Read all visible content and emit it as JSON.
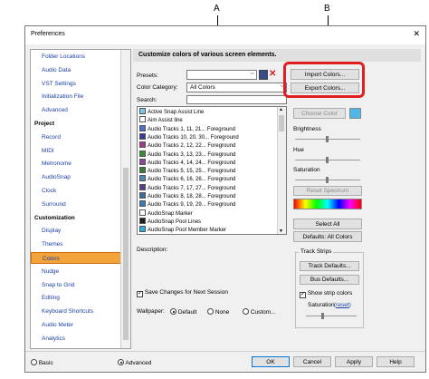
{
  "callouts": {
    "a": "A",
    "b": "B"
  },
  "window": {
    "title": "Preferences",
    "close_glyph": "✕"
  },
  "sidebar": {
    "items": [
      {
        "label": "Folder Locations",
        "style": "blue"
      },
      {
        "label": "Audio Data",
        "style": "blue"
      },
      {
        "label": "VST Settings",
        "style": "blue"
      },
      {
        "label": "Initialization File",
        "style": "blue"
      },
      {
        "label": "Advanced",
        "style": "blue"
      },
      {
        "label": "Project",
        "style": "hdr"
      },
      {
        "label": "Record",
        "style": "blue"
      },
      {
        "label": "MIDI",
        "style": "blue"
      },
      {
        "label": "Metronome",
        "style": "blue"
      },
      {
        "label": "AudioSnap",
        "style": "blue"
      },
      {
        "label": "Clock",
        "style": "blue"
      },
      {
        "label": "Surround",
        "style": "blue"
      },
      {
        "label": "Customization",
        "style": "hdr"
      },
      {
        "label": "Display",
        "style": "blue"
      },
      {
        "label": "Themes",
        "style": "blue"
      },
      {
        "label": "Colors",
        "style": "sel"
      },
      {
        "label": "Nudge",
        "style": "blue"
      },
      {
        "label": "Snap to Grid",
        "style": "blue"
      },
      {
        "label": "Editing",
        "style": "blue"
      },
      {
        "label": "Keyboard Shortcuts",
        "style": "blue"
      },
      {
        "label": "Audio Meter",
        "style": "blue"
      },
      {
        "label": "Analytics",
        "style": "blue"
      }
    ]
  },
  "header": {
    "title": "Customize colors of various screen elements."
  },
  "presets": {
    "label": "Presets:",
    "value": ""
  },
  "color_category": {
    "label": "Color Category:",
    "value": "All Colors"
  },
  "search": {
    "label": "Search:",
    "value": ""
  },
  "color_list": [
    {
      "label": "Active Snap Assist Line",
      "color": "#7ec8e3"
    },
    {
      "label": "Aim Assist line",
      "color": "#ffffff"
    },
    {
      "label": "Audio Tracks 1, 11, 21... Foreground",
      "color": "#4a6fc4"
    },
    {
      "label": "Audio Tracks 10, 20, 30... Foreground",
      "color": "#3a3a9a"
    },
    {
      "label": "Audio Tracks 2, 12, 22... Foreground",
      "color": "#a03a8a"
    },
    {
      "label": "Audio Tracks 3, 13, 23... Foreground",
      "color": "#3a8a3a"
    },
    {
      "label": "Audio Tracks 4, 14, 24... Foreground",
      "color": "#8a4a9a"
    },
    {
      "label": "Audio Tracks 5, 15, 25... Foreground",
      "color": "#3a7a3a"
    },
    {
      "label": "Audio Tracks 6, 16, 26... Foreground",
      "color": "#4a8ab4"
    },
    {
      "label": "Audio Tracks 7, 17, 27... Foreground",
      "color": "#5a3a8a"
    },
    {
      "label": "Audio Tracks 8, 18, 28... Foreground",
      "color": "#3a6a9a"
    },
    {
      "label": "Audio Tracks 9, 19, 29... Foreground",
      "color": "#3a7ab4"
    },
    {
      "label": "AudioSnap Marker",
      "color": "#ffffff"
    },
    {
      "label": "AudioSnap Pool Lines",
      "color": "#202020"
    },
    {
      "label": "AudioSnap Pool Member Marker",
      "color": "#2ab0d8"
    }
  ],
  "buttons": {
    "import_colors": "Import Colors...",
    "export_colors": "Export Colors...",
    "choose_color": "Choose Color",
    "reset_spectrum": "Reset Spectrum",
    "select_all": "Select All",
    "defaults_all": "Defaults: All Colors",
    "track_defaults": "Track Defaults...",
    "bus_defaults": "Bus Defaults..."
  },
  "swatch_color": "#4fb8e8",
  "labels": {
    "brightness": "Brightness",
    "hue": "Hue",
    "saturation": "Saturation",
    "description": "Description:",
    "track_strips": "Track Strips",
    "show_strip_colors": "Show strip colors",
    "strip_saturation": "Saturation",
    "reset": "reset",
    "save_changes": "Save Changes for Next Session",
    "wallpaper": "Wallpaper:",
    "wp_default": "Default",
    "wp_none": "None",
    "wp_custom": "Custom..."
  },
  "footer": {
    "basic": "Basic",
    "advanced": "Advanced",
    "ok": "OK",
    "cancel": "Cancel",
    "apply": "Apply",
    "help": "Help"
  }
}
